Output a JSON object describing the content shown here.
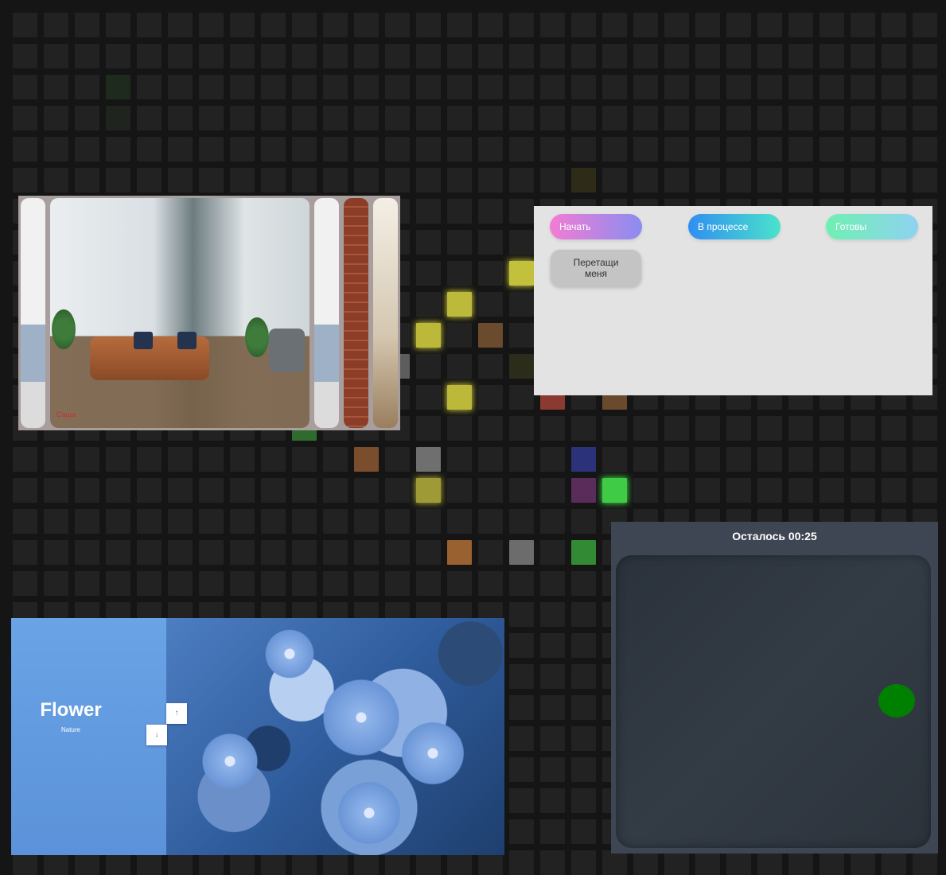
{
  "lit_cells": [
    {
      "row": 2,
      "col": 3,
      "color": "#1e2a1e",
      "glow": false
    },
    {
      "row": 3,
      "col": 3,
      "color": "#1f241f",
      "glow": false
    },
    {
      "row": 5,
      "col": 18,
      "color": "#2e2b19",
      "glow": false
    },
    {
      "row": 8,
      "col": 16,
      "color": "#c3c03b",
      "glow": true
    },
    {
      "row": 9,
      "col": 14,
      "color": "#bdb93a",
      "glow": true
    },
    {
      "row": 10,
      "col": 13,
      "color": "#bbb83a",
      "glow": true
    },
    {
      "row": 10,
      "col": 15,
      "color": "#6a4b2d",
      "glow": false
    },
    {
      "row": 11,
      "col": 12,
      "color": "#5d5d5d",
      "glow": false
    },
    {
      "row": 11,
      "col": 16,
      "color": "#2c2c1a",
      "glow": false
    },
    {
      "row": 12,
      "col": 14,
      "color": "#bbb83a",
      "glow": true
    },
    {
      "row": 12,
      "col": 17,
      "color": "#8a3a30",
      "glow": false
    },
    {
      "row": 12,
      "col": 19,
      "color": "#6a4a2c",
      "glow": false
    },
    {
      "row": 13,
      "col": 9,
      "color": "#2f6b2f",
      "glow": false
    },
    {
      "row": 14,
      "col": 11,
      "color": "#7a4d2c",
      "glow": false
    },
    {
      "row": 14,
      "col": 13,
      "color": "#6f6f6f",
      "glow": false
    },
    {
      "row": 14,
      "col": 18,
      "color": "#2b327a",
      "glow": false
    },
    {
      "row": 15,
      "col": 13,
      "color": "#9e9a35",
      "glow": true
    },
    {
      "row": 15,
      "col": 18,
      "color": "#5a2c5a",
      "glow": false
    },
    {
      "row": 15,
      "col": 19,
      "color": "#3fcb45",
      "glow": true
    },
    {
      "row": 17,
      "col": 14,
      "color": "#9a6130",
      "glow": false
    },
    {
      "row": 17,
      "col": 16,
      "color": "#6c6c6c",
      "glow": false
    },
    {
      "row": 17,
      "col": 18,
      "color": "#328a34",
      "glow": false
    }
  ],
  "gallery": {
    "caption": "Саша"
  },
  "kanban": {
    "columns": [
      {
        "label": "Начать",
        "gradient": [
          "#f27cd3",
          "#8a8df0"
        ]
      },
      {
        "label": "В процессе",
        "gradient": [
          "#2f8ff0",
          "#4be2cc"
        ]
      },
      {
        "label": "Готовы",
        "gradient": [
          "#6ff0b2",
          "#8fd2f0"
        ]
      }
    ],
    "drag_card": "Перетащи\nменя"
  },
  "game": {
    "timer_text": "Осталось 00:25",
    "ball_color": "#008000"
  },
  "flower_card": {
    "title": "Flower",
    "subtitle": "Nature",
    "nav": {
      "up": "↑",
      "down": "↓"
    }
  }
}
